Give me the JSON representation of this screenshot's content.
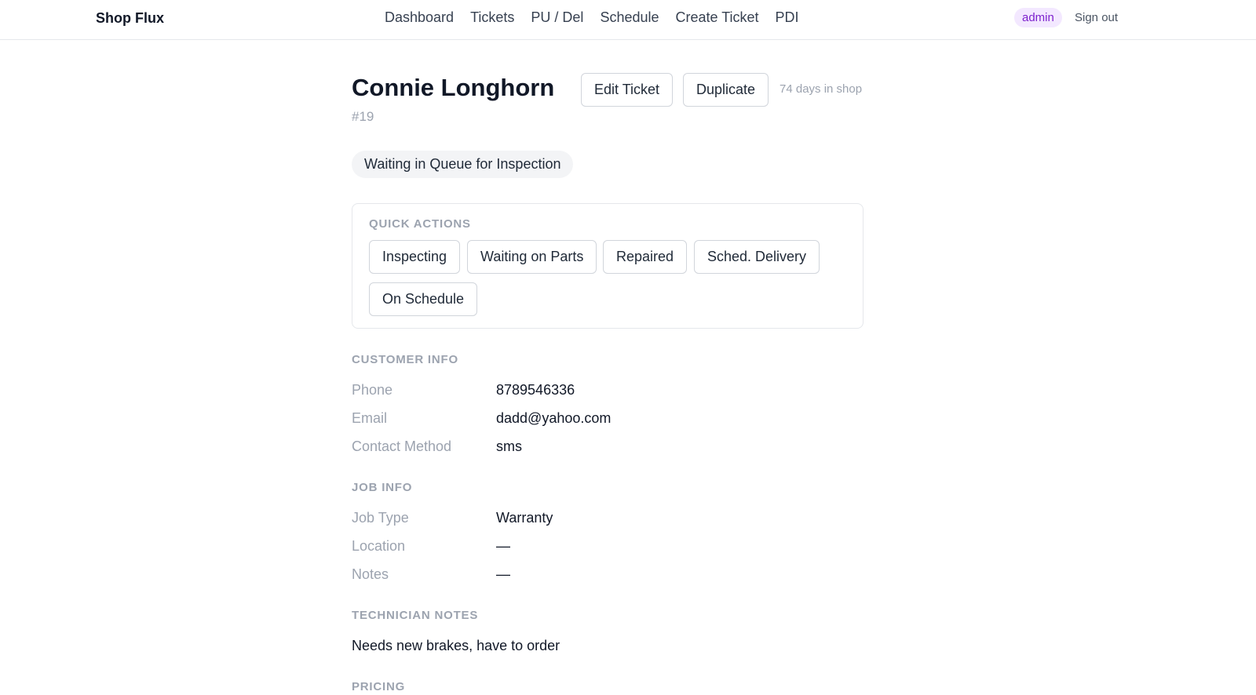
{
  "header": {
    "brand": "Shop Flux",
    "nav": [
      "Dashboard",
      "Tickets",
      "PU / Del",
      "Schedule",
      "Create Ticket",
      "PDI"
    ],
    "role_badge": "admin",
    "sign_out": "Sign out"
  },
  "ticket": {
    "customer_name": "Connie Longhorn",
    "number": "#19",
    "edit_label": "Edit Ticket",
    "duplicate_label": "Duplicate",
    "days_in_shop": "74 days in shop",
    "status": "Waiting in Queue for Inspection"
  },
  "quick_actions": {
    "title": "QUICK ACTIONS",
    "actions": [
      "Inspecting",
      "Waiting on Parts",
      "Repaired",
      "Sched. Delivery",
      "On Schedule"
    ]
  },
  "customer_info": {
    "title": "CUSTOMER INFO",
    "rows": [
      {
        "label": "Phone",
        "value": "8789546336"
      },
      {
        "label": "Email",
        "value": "dadd@yahoo.com"
      },
      {
        "label": "Contact Method",
        "value": "sms"
      }
    ]
  },
  "job_info": {
    "title": "JOB INFO",
    "rows": [
      {
        "label": "Job Type",
        "value": "Warranty"
      },
      {
        "label": "Location",
        "value": "—"
      },
      {
        "label": "Notes",
        "value": "—"
      }
    ]
  },
  "technician_notes": {
    "title": "TECHNICIAN NOTES",
    "text": "Needs new brakes, have to order"
  },
  "pricing": {
    "title": "PRICING"
  },
  "colors": {
    "role_badge_bg": "#f3e8ff",
    "role_badge_text": "#7e22ce",
    "status_pill_bg": "#f3f4f6",
    "muted_text": "#9ca3af"
  }
}
